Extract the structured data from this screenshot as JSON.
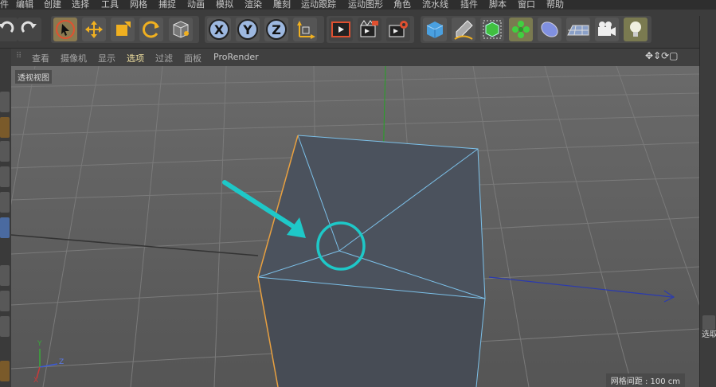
{
  "menu": [
    "件",
    "编辑",
    "创建",
    "选择",
    "工具",
    "网格",
    "捕捉",
    "动画",
    "模拟",
    "渲染",
    "雕刻",
    "运动跟踪",
    "运动图形",
    "角色",
    "流水线",
    "插件",
    "脚本",
    "窗口",
    "帮助"
  ],
  "toolbar": {
    "icons": [
      "undo-icon",
      "redo-icon",
      "live-select-icon",
      "move-icon",
      "scale-icon",
      "rotate-icon",
      "recent-tool-icon",
      "x-axis-lock-icon",
      "y-axis-lock-icon",
      "z-axis-lock-icon",
      "coordinate-system-icon",
      "render-view-icon",
      "render-to-picture-viewer-icon",
      "render-settings-icon",
      "cube-icon",
      "pen-icon",
      "subdivision-icon",
      "cloner-icon",
      "deformer-icon",
      "floor-icon",
      "camera-icon",
      "light-icon"
    ],
    "x_label": "X",
    "y_label": "Y",
    "z_label": "Z"
  },
  "viewport_menu": {
    "items": [
      "查看",
      "摄像机",
      "显示",
      "选项",
      "过滤",
      "面板",
      "ProRender"
    ],
    "active": "选项"
  },
  "viewport": {
    "label": "透视视图",
    "grid_info": "网格间距 : 100 cm",
    "axis_x": "X",
    "axis_y": "Y",
    "axis_z": "Z"
  },
  "right_panel": {
    "label": "选取"
  },
  "colors": {
    "annotation": "#1ec8c8",
    "selected_edge": "#e8a040",
    "mesh_edge": "#7cc0e8",
    "y_axis": "#3aa83a",
    "x_axis": "#c83a3a",
    "z_axis": "#3a5ad8"
  }
}
